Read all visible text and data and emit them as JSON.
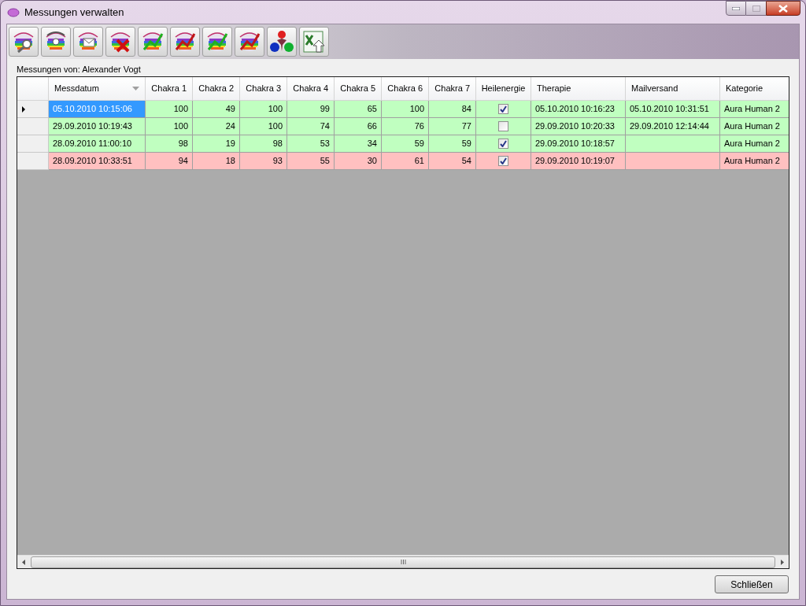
{
  "window": {
    "title": "Messungen verwalten"
  },
  "owner_label": "Messungen von: Alexander Vogt",
  "table": {
    "columns": [
      "Messdatum",
      "Chakra 1",
      "Chakra 2",
      "Chakra 3",
      "Chakra 4",
      "Chakra 5",
      "Chakra 6",
      "Chakra 7",
      "Heilenergie",
      "Therapie",
      "Mailversand",
      "Kategorie"
    ],
    "rows": [
      {
        "selected": true,
        "color": "#c0ffc0",
        "messdatum": "05.10.2010 10:15:06",
        "chakras": [
          "100",
          "49",
          "100",
          "99",
          "65",
          "100",
          "84"
        ],
        "heilenergie": true,
        "therapie": "05.10.2010 10:16:23",
        "mailversand": "05.10.2010 10:31:51",
        "kategorie": "Aura Human 2"
      },
      {
        "selected": false,
        "color": "#c0ffc0",
        "messdatum": "29.09.2010 10:19:43",
        "chakras": [
          "100",
          "24",
          "100",
          "74",
          "66",
          "76",
          "77"
        ],
        "heilenergie": false,
        "therapie": "29.09.2010 10:20:33",
        "mailversand": "29.09.2010 12:14:44",
        "kategorie": "Aura Human 2"
      },
      {
        "selected": false,
        "color": "#c0ffc0",
        "messdatum": "28.09.2010 11:00:10",
        "chakras": [
          "98",
          "19",
          "98",
          "53",
          "34",
          "59",
          "59"
        ],
        "heilenergie": true,
        "therapie": "29.09.2010 10:18:57",
        "kategorie": "Aura Human 2"
      },
      {
        "selected": false,
        "color": "#ffc0c0",
        "messdatum": "28.09.2010 10:33:51",
        "chakras": [
          "94",
          "18",
          "93",
          "55",
          "30",
          "61",
          "54"
        ],
        "heilenergie": true,
        "therapie": "29.09.2010 10:19:07",
        "kategorie": "Aura Human 2"
      }
    ]
  },
  "close_button": "Schließen"
}
